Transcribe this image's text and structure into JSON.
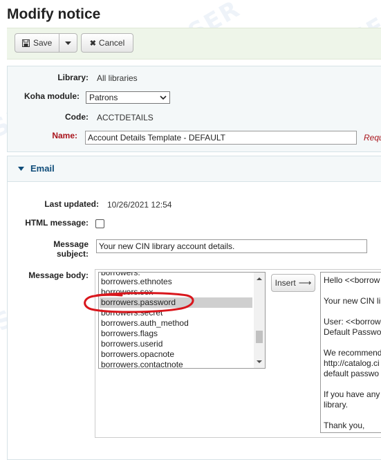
{
  "page": {
    "title": "Modify notice"
  },
  "watermark": "SER",
  "toolbar": {
    "save_label": "Save",
    "cancel_label": "Cancel"
  },
  "form": {
    "library_label": "Library:",
    "library_value": "All libraries",
    "module_label": "Koha module:",
    "module_value": "Patrons",
    "code_label": "Code:",
    "code_value": "ACCTDETAILS",
    "name_label": "Name:",
    "name_value": "Account Details Template - DEFAULT",
    "required_label": "Requ"
  },
  "email": {
    "section_title": "Email",
    "last_updated_label": "Last updated:",
    "last_updated_value": "10/26/2021 12:54",
    "html_label": "HTML message:",
    "html_checked": false,
    "subject_label_1": "Message",
    "subject_label_2": "subject:",
    "subject_value": "Your new CIN library account details.",
    "body_label": "Message body:",
    "insert_label": "Insert",
    "fields": [
      "borrowers.ethnotes",
      "borrowers.sex",
      "borrowers.password",
      "borrowers.secret",
      "borrowers.auth_method",
      "borrowers.flags",
      "borrowers.userid",
      "borrowers.opacnote",
      "borrowers.contactnote"
    ],
    "selected_field": "borrowers.password",
    "body_lines": [
      "Hello <<borrow",
      "",
      "Your new CIN li",
      "",
      "User:  <<borrow",
      "Default Passwo",
      "",
      "We recommend",
      "http://catalog.ci",
      "default passwo",
      "",
      "If you have any",
      "library.",
      "",
      "Thank you,"
    ]
  },
  "colors": {
    "annotation": "#d9161c",
    "link": "#0f4d7a",
    "required": "#a9141c"
  }
}
